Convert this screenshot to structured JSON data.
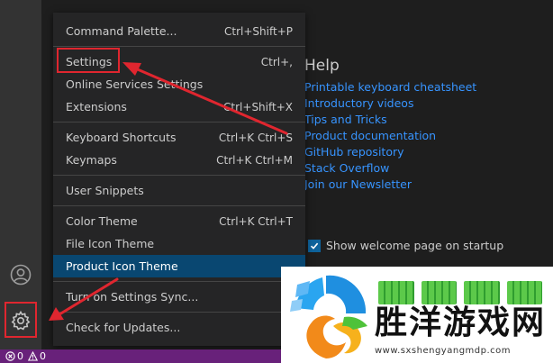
{
  "menu": {
    "items": [
      {
        "label": "Command Palette...",
        "shortcut": "Ctrl+Shift+P"
      },
      {
        "label": "Settings",
        "shortcut": "Ctrl+,"
      },
      {
        "label": "Online Services Settings",
        "shortcut": ""
      },
      {
        "label": "Extensions",
        "shortcut": "Ctrl+Shift+X"
      },
      {
        "label": "Keyboard Shortcuts",
        "shortcut": "Ctrl+K Ctrl+S"
      },
      {
        "label": "Keymaps",
        "shortcut": "Ctrl+K Ctrl+M"
      },
      {
        "label": "User Snippets",
        "shortcut": ""
      },
      {
        "label": "Color Theme",
        "shortcut": "Ctrl+K Ctrl+T"
      },
      {
        "label": "File Icon Theme",
        "shortcut": ""
      },
      {
        "label": "Product Icon Theme",
        "shortcut": ""
      },
      {
        "label": "Turn on Settings Sync...",
        "shortcut": ""
      },
      {
        "label": "Check for Updates...",
        "shortcut": ""
      }
    ]
  },
  "help": {
    "title": "Help",
    "links": [
      "Printable keyboard cheatsheet",
      "Introductory videos",
      "Tips and Tricks",
      "Product documentation",
      "GitHub repository",
      "Stack Overflow",
      "Join our Newsletter"
    ]
  },
  "startup": {
    "label": "Show welcome page on startup",
    "checked": true
  },
  "status": {
    "errors": "0",
    "warnings": "0"
  },
  "watermark": {
    "title": "胜洋游戏网",
    "url": "www.sxshengyangmdp.com"
  },
  "icons": {
    "account": "account-icon",
    "manage": "gear-icon"
  },
  "colors": {
    "highlight": "#e0262f",
    "status_bar": "#68217a",
    "link": "#3794ff",
    "menu_active": "#094771"
  }
}
